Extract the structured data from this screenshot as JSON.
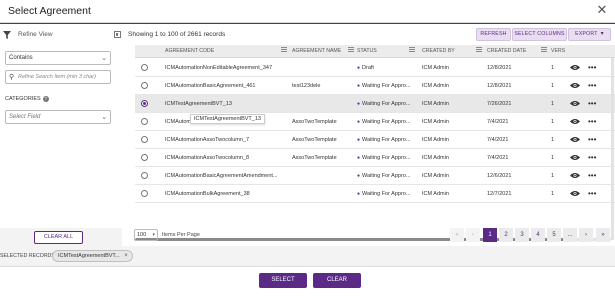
{
  "dialog": {
    "title": "Select Agreement",
    "close_glyph": "✕"
  },
  "filters": {
    "refine_label": "Refine View",
    "operator": "Contains",
    "search_placeholder": "Refine Search Item (min 3 char)",
    "categories_label": "CATEGORIES",
    "field_placeholder": "Select Field",
    "clear_all": "CLEAR ALL"
  },
  "toolbar": {
    "showing": "Showing 1 to 100 of 2661 records",
    "refresh": "REFRESH",
    "select_columns": "SELECT COLUMNS",
    "export": "EXPORT"
  },
  "table": {
    "columns": [
      "AGREEMENT CODE",
      "AGREEMENT NAME",
      "STATUS",
      "CREATED BY",
      "CREATED DATE",
      "VERS"
    ],
    "rows": [
      {
        "code": "ICMAutomationNonEditableAgreement_347",
        "name": "",
        "status": "Draft",
        "created_by": "ICM Admin",
        "date": "12/8/2021",
        "version": "1",
        "selected": false
      },
      {
        "code": "ICMAutomationBasicAgreement_461",
        "name": "test123dele",
        "status": "Waiting For Appro...",
        "created_by": "ICM Admin",
        "date": "12/8/2021",
        "version": "1",
        "selected": false
      },
      {
        "code": "ICMTestAgreementBVT_13",
        "name": "",
        "status": "Waiting For Appro...",
        "created_by": "ICM Admin",
        "date": "7/26/2021",
        "version": "1",
        "selected": true
      },
      {
        "code": "ICMAutomationAssoTwocolumn_6",
        "name": "AssoTwoTemplate",
        "status": "Waiting For Appro...",
        "created_by": "ICM Admin",
        "date": "7/4/2021",
        "version": "1",
        "selected": false
      },
      {
        "code": "ICMAutomationAssoTwocolumn_7",
        "name": "AssoTwoTemplate",
        "status": "Waiting For Appro...",
        "created_by": "ICM Admin",
        "date": "7/4/2021",
        "version": "1",
        "selected": false
      },
      {
        "code": "ICMAutomationAssoTwocolumn_8",
        "name": "AssoTwoTemplate",
        "status": "Waiting For Appro...",
        "created_by": "ICM Admin",
        "date": "7/4/2021",
        "version": "1",
        "selected": false
      },
      {
        "code": "ICMAutomationBasicAgreementAmendment...",
        "name": "",
        "status": "Waiting For Appro...",
        "created_by": "ICM Admin",
        "date": "12/6/2021",
        "version": "1",
        "selected": false
      },
      {
        "code": "ICMAutomationBulkAgreement_38",
        "name": "",
        "status": "Waiting For Appro...",
        "created_by": "ICM Admin",
        "date": "12/7/2021",
        "version": "1",
        "selected": false
      }
    ],
    "tooltip": "ICMTestAgreementBVT_13"
  },
  "pagination": {
    "per_page": "100",
    "per_page_label": "Items Per Page",
    "first": "«",
    "prev": "‹",
    "pages": [
      "1",
      "2",
      "3",
      "4",
      "5"
    ],
    "ellipsis": "...",
    "next": "›",
    "last": "»",
    "active_page": "1"
  },
  "selected": {
    "label": "SELECTED RECORDS",
    "chip": "ICMTestAgreementBVT...",
    "chip_remove": "×"
  },
  "footer": {
    "select": "SELECT",
    "clear": "CLEAR"
  },
  "colors": {
    "accent": "#5b2a86",
    "accent_light": "#e9def0"
  },
  "icons": {
    "filter": "filter-icon",
    "search": "search-icon",
    "eye": "eye-icon",
    "more": "more-icon"
  }
}
